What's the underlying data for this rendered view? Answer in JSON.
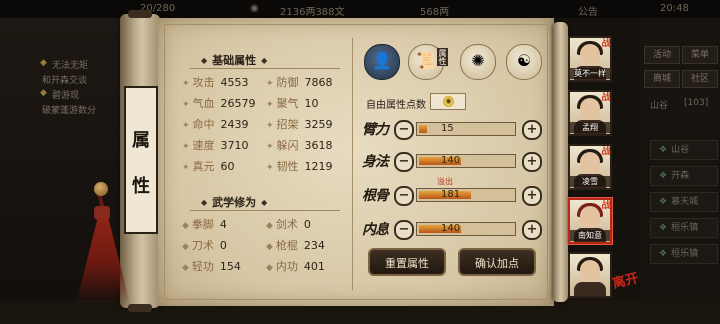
{
  "top_bar": {
    "resource_a": "20/280",
    "money": "2136两388文",
    "silver": "568两",
    "notice": "公告",
    "time": "20:48"
  },
  "background_left": {
    "quests": [
      {
        "text": "无法无矩"
      },
      {
        "text": "和开森交谈"
      },
      {
        "text": "碧游现"
      },
      {
        "text": "破蒙蓬游数分"
      }
    ]
  },
  "background_right": {
    "buttons": [
      "活动",
      "菜单",
      "商城",
      "社区"
    ],
    "location": "山谷",
    "coords": "[103]",
    "list": [
      "山谷",
      "开森",
      "慕天城",
      "桓乐镇",
      "桓乐镇"
    ]
  },
  "title_plaque": {
    "line1": "属",
    "line2": "性"
  },
  "basic_attributes": {
    "title": "基础属性",
    "stats": [
      {
        "label": "攻击",
        "value": "4553"
      },
      {
        "label": "防御",
        "value": "7868"
      },
      {
        "label": "气血",
        "value": "26579"
      },
      {
        "label": "聚气",
        "value": "10"
      },
      {
        "label": "命中",
        "value": "2439"
      },
      {
        "label": "招架",
        "value": "3259"
      },
      {
        "label": "速度",
        "value": "3710"
      },
      {
        "label": "躲闪",
        "value": "3618"
      },
      {
        "label": "真元",
        "value": "60"
      },
      {
        "label": "韧性",
        "value": "1219"
      }
    ]
  },
  "martial_skills": {
    "title": "武学修为",
    "stats": [
      {
        "label": "拳脚",
        "value": "4"
      },
      {
        "label": "剑术",
        "value": "0"
      },
      {
        "label": "刀术",
        "value": "0"
      },
      {
        "label": "枪棍",
        "value": "234"
      },
      {
        "label": "轻功",
        "value": "154"
      },
      {
        "label": "内功",
        "value": "401"
      }
    ]
  },
  "tabs": {
    "tag_text": "属性"
  },
  "free_points": {
    "label": "自由属性点数"
  },
  "point_alloc": [
    {
      "name": "臂力",
      "value": "15",
      "fill": 0.08
    },
    {
      "name": "身法",
      "value": "140",
      "fill": 0.45
    },
    {
      "name": "根骨",
      "value": "181",
      "fill": 0.55
    },
    {
      "name": "内息",
      "value": "140",
      "fill": 0.45
    }
  ],
  "overflow_label": "溢出",
  "actions": {
    "reset": "重置属性",
    "confirm": "确认加点"
  },
  "party": [
    {
      "name": "莫不一样",
      "badge": "战"
    },
    {
      "name": "孟翔",
      "badge": "战"
    },
    {
      "name": "凌雪",
      "badge": "战"
    },
    {
      "name": "南知意",
      "badge": "战"
    },
    {
      "name": "",
      "badge": ""
    }
  ],
  "seal_text": "离开"
}
